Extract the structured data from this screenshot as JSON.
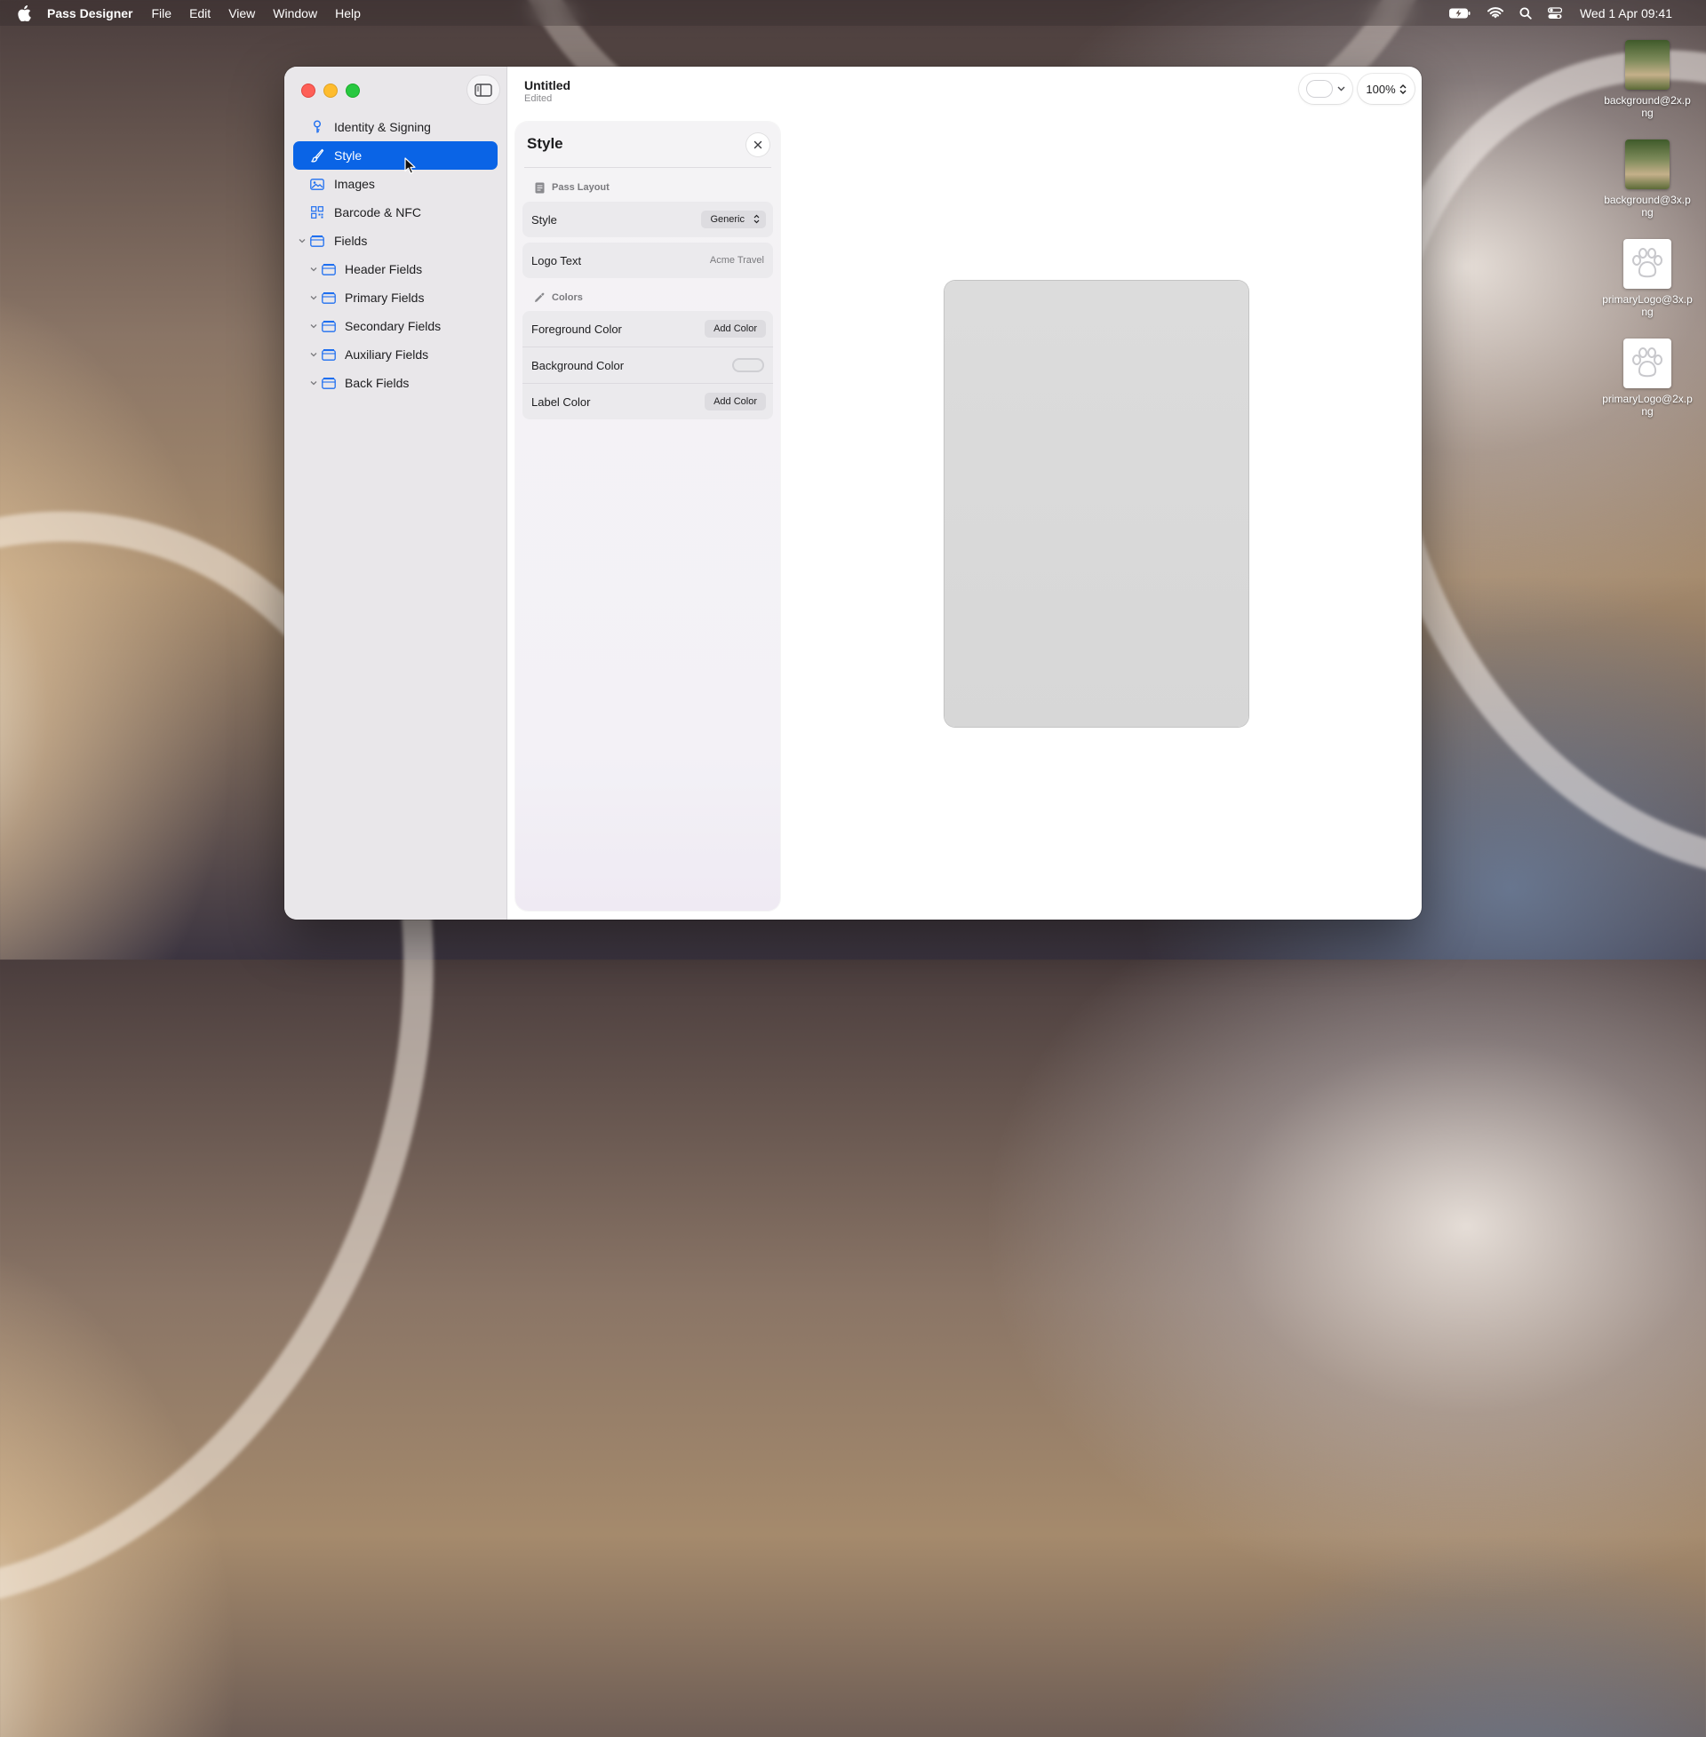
{
  "menubar": {
    "app_name": "Pass Designer",
    "menus": [
      "File",
      "Edit",
      "View",
      "Window",
      "Help"
    ],
    "clock": "Wed 1 Apr  09:41"
  },
  "window": {
    "title": "Untitled",
    "subtitle": "Edited",
    "zoom": "100%"
  },
  "sidebar": {
    "items": [
      {
        "label": "Identity & Signing",
        "icon": "key-icon"
      },
      {
        "label": "Style",
        "icon": "brush-icon",
        "selected": true
      },
      {
        "label": "Images",
        "icon": "photo-icon"
      },
      {
        "label": "Barcode & NFC",
        "icon": "barcode-icon"
      },
      {
        "label": "Fields",
        "icon": "folder-icon"
      },
      {
        "label": "Header Fields",
        "icon": "folder-icon"
      },
      {
        "label": "Primary Fields",
        "icon": "folder-icon"
      },
      {
        "label": "Secondary Fields",
        "icon": "folder-icon"
      },
      {
        "label": "Auxiliary Fields",
        "icon": "folder-icon"
      },
      {
        "label": "Back Fields",
        "icon": "folder-icon"
      }
    ]
  },
  "inspector": {
    "title": "Style",
    "pass_layout": {
      "header": "Pass Layout",
      "style_label": "Style",
      "style_value": "Generic",
      "logo_text_label": "Logo Text",
      "logo_text_value": "Acme Travel"
    },
    "colors": {
      "header": "Colors",
      "foreground_label": "Foreground Color",
      "foreground_button": "Add Color",
      "background_label": "Background Color",
      "label_label": "Label Color",
      "label_button": "Add Color"
    }
  },
  "desktop": {
    "files": [
      {
        "name": "background@2x.png",
        "kind": "photo"
      },
      {
        "name": "background@3x.png",
        "kind": "photo"
      },
      {
        "name": "primaryLogo@3x.png",
        "kind": "paw"
      },
      {
        "name": "primaryLogo@2x.png",
        "kind": "paw"
      }
    ]
  },
  "colors": {
    "accent": "#0a64e6",
    "close": "#fe5f57",
    "minimize": "#febc2e",
    "maximize": "#28c840"
  }
}
